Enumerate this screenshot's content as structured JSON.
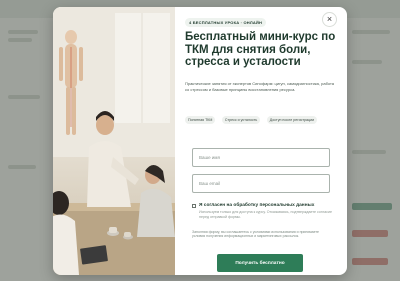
{
  "modal": {
    "badge": "4 БЕСПЛАТНЫХ УРОКА · ОНЛАЙН",
    "close_label": "×",
    "title": "Бесплатный мини-курс по ТКМ для снятия боли, стресса и усталости",
    "description": "Практические занятия от экспертов Синофарм: цигун, самодиагностика, работа со стрессом и базовые принципы восстановления ресурса.",
    "tags": [
      "Понятная ТКМ",
      "Стресс и усталость",
      "Доступ после регистрации"
    ],
    "form": {
      "name_placeholder": "Ваше имя",
      "email_placeholder": "Ваш email",
      "consent_label": "Я согласен на обработку персональных данных",
      "consent_text": "Используем только для доступа к курсу. Отказываясь, подтверждаете согласие перед отправкой формы.",
      "footnote": "Заполняя форму, вы соглашаетесь с условиями использования и принимаете условия получения информационных и маркетинговых рассылок.",
      "submit_label": "Получить бесплатно"
    }
  },
  "colors": {
    "accent_green": "#2e7d58",
    "title_text": "#1f3a2d",
    "overlay": "#3c423c"
  },
  "icons": {
    "close": "close-icon"
  }
}
